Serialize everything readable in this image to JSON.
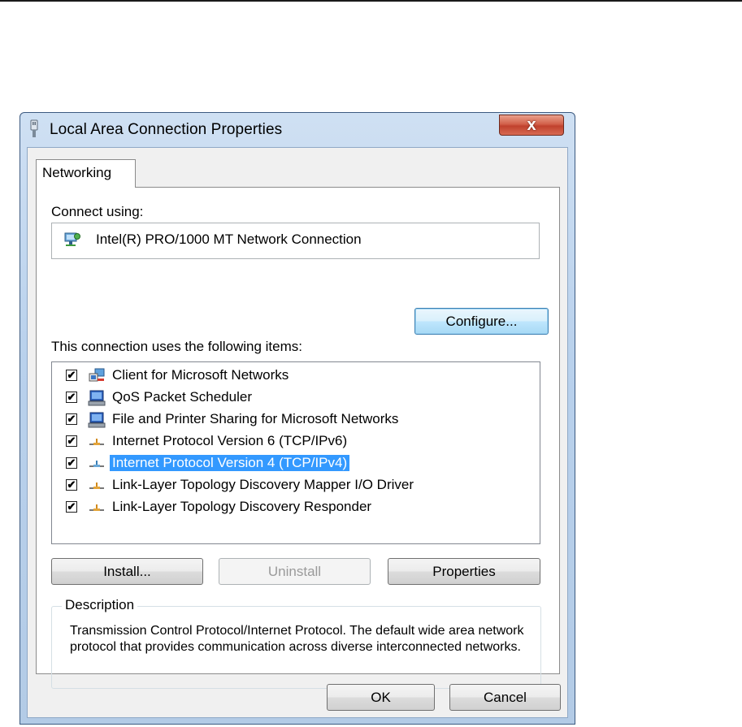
{
  "window": {
    "title": "Local Area Connection Properties",
    "close_glyph": "x",
    "title_icon": "network-adapter-icon"
  },
  "tabs": [
    {
      "label": "Networking",
      "selected": true
    }
  ],
  "connect_using": {
    "label": "Connect using:",
    "adapter": "Intel(R) PRO/1000 MT Network Connection",
    "adapter_icon": "network-adapter-icon",
    "configure_label": "Configure..."
  },
  "items_section": {
    "label": "This connection uses the following items:",
    "items": [
      {
        "label": "Client for Microsoft Networks",
        "checked": true,
        "icon": "network-client-icon"
      },
      {
        "label": "QoS Packet Scheduler",
        "checked": true,
        "icon": "service-icon"
      },
      {
        "label": "File and Printer Sharing for Microsoft Networks",
        "checked": true,
        "icon": "service-icon"
      },
      {
        "label": "Internet Protocol Version 6 (TCP/IPv6)",
        "checked": true,
        "icon": "protocol-icon"
      },
      {
        "label": "Internet Protocol Version 4 (TCP/IPv4)",
        "checked": true,
        "icon": "protocol-icon",
        "selected": true
      },
      {
        "label": "Link-Layer Topology Discovery Mapper I/O Driver",
        "checked": true,
        "icon": "protocol-icon"
      },
      {
        "label": "Link-Layer Topology Discovery Responder",
        "checked": true,
        "icon": "protocol-icon"
      }
    ]
  },
  "item_buttons": {
    "install": "Install...",
    "uninstall": "Uninstall",
    "properties": "Properties"
  },
  "description": {
    "legend": "Description",
    "text": "Transmission Control Protocol/Internet Protocol. The default wide area network protocol that provides communication across diverse interconnected networks."
  },
  "dialog_buttons": {
    "ok": "OK",
    "cancel": "Cancel"
  },
  "colors": {
    "selection": "#3399ff",
    "close_button": "#c0412d",
    "frame": "#b9d1ec"
  }
}
